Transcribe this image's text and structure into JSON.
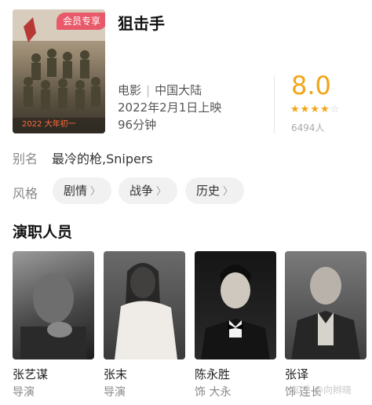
{
  "poster": {
    "vip_badge": "会员专享",
    "strip_text": "2022 大年初一"
  },
  "movie": {
    "title": "狙击手",
    "type": "电影",
    "region": "中国大陆",
    "release": "2022年2月1日上映",
    "duration": "96分钟"
  },
  "rating": {
    "score": "8.0",
    "stars_filled": 4,
    "stars_total": 5,
    "votes": "6494人",
    "color": "#f2a516"
  },
  "alias": {
    "label": "别名",
    "value": "最冷的枪,Snipers"
  },
  "genre": {
    "label": "风格",
    "tags": [
      "剧情",
      "战争",
      "历史"
    ]
  },
  "cast": {
    "heading": "演职人员",
    "people": [
      {
        "name": "张艺谋",
        "role": "导演"
      },
      {
        "name": "张末",
        "role": "导演"
      },
      {
        "name": "陈永胜",
        "role": "饰 大永"
      },
      {
        "name": "张译",
        "role": "饰 连长"
      }
    ]
  },
  "watermark": "知乎 @向辫晓"
}
